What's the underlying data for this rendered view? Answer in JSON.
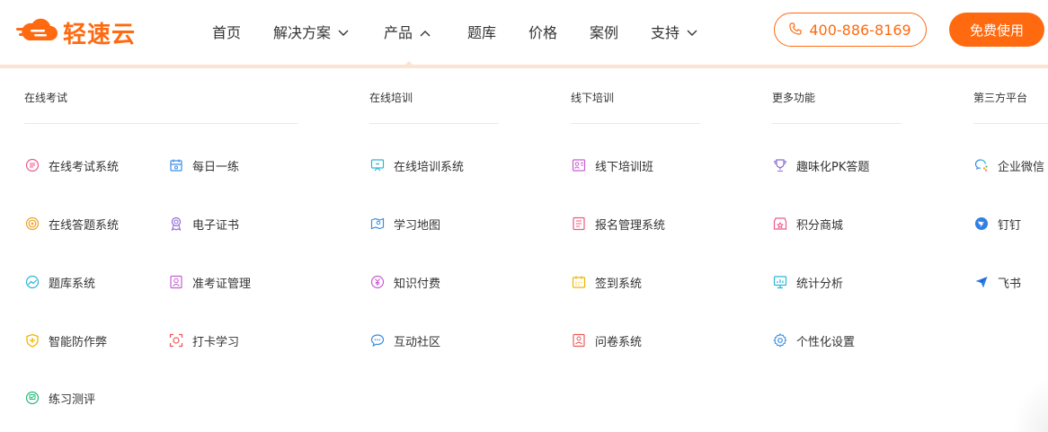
{
  "brand": {
    "name": "轻速云",
    "color": "#ff6a10"
  },
  "nav": {
    "home": "首页",
    "solutions": "解决方案",
    "products": "产品",
    "question_bank": "题库",
    "pricing": "价格",
    "cases": "案例",
    "support": "支持"
  },
  "header": {
    "phone": "400-886-8169",
    "trial": "免费使用"
  },
  "menu": {
    "online_exam": {
      "title": "在线考试",
      "items": [
        "在线考试系统",
        "每日一练",
        "在线答题系统",
        "电子证书",
        "题库系统",
        "准考证管理",
        "智能防作弊",
        "打卡学习",
        "练习测评"
      ]
    },
    "online_training": {
      "title": "在线培训",
      "items": [
        "在线培训系统",
        "学习地图",
        "知识付费",
        "互动社区"
      ]
    },
    "offline_training": {
      "title": "线下培训",
      "items": [
        "线下培训班",
        "报名管理系统",
        "签到系统",
        "问卷系统"
      ]
    },
    "more": {
      "title": "更多功能",
      "items": [
        "趣味化PK答题",
        "积分商城",
        "统计分析",
        "个性化设置"
      ]
    },
    "third_party": {
      "title": "第三方平台",
      "items": [
        "企业微信",
        "钉钉",
        "飞书"
      ]
    }
  }
}
